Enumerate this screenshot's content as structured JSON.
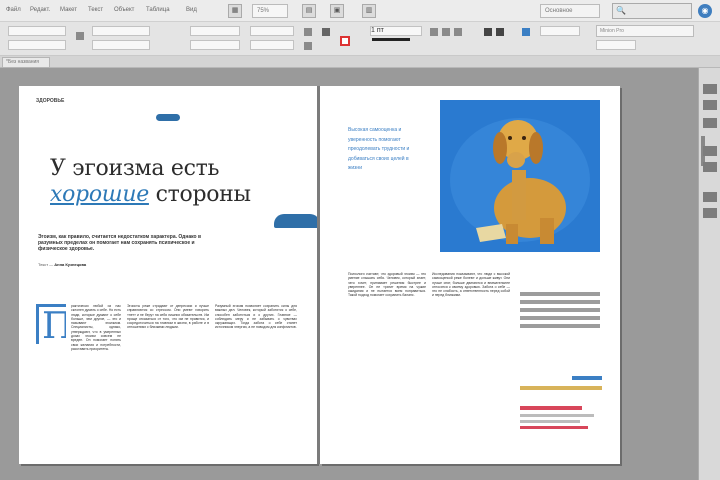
{
  "menubar": {
    "items": [
      "Файл",
      "Редакт.",
      "Макет",
      "Текст",
      "Объект",
      "Таблица",
      "Вид"
    ],
    "zoom": "75%",
    "workspace": "Основное",
    "search_placeholder": "🔍"
  },
  "controlbar": {
    "font_name": "Minion Pro",
    "stroke_weight": "1 пт"
  },
  "tab": {
    "label": "*Без названия"
  },
  "spread": {
    "left": {
      "runner": "ЗДОРОВЬЕ",
      "headline_line1": "У эгоизма есть",
      "headline_word2": "хорошие",
      "headline_word3": " стороны",
      "lead": "Эгоизм, как правило, считается недостатком характера. Однако в разумных пределах он помогает нам сохранять психическое и физическое здоровье.",
      "byline_prefix": "Текст — ",
      "byline_name": "Анна Кузнецова",
      "dropcap": "П",
      "col1": "рактически любой из нас склонен думать о себе. Но есть люди, которые думают о себе больше, чем другие, — это и называют эгоизмом. Специалисты, однако, утверждают, что в умеренных дозах эгоизм совсем не вреден. Он помогает понять свои желания и потребности, расставить приоритеты.",
      "col2": "Эгоисты реже страдают от депрессии и лучше справляются со стрессом. Они умеют говорить «нет» и не берут на себя лишних обязательств. Им проще отказаться от того, что им не нравится, и сосредоточиться на главном в жизни, в работе и в отношениях с близкими людьми.",
      "col3": "Разумный эгоизм позволяет сохранить силы для важных дел. Человек, который заботится о себе, способен заботиться и о других. Главное — соблюдать меру и не забывать о чувствах окружающих. Тогда забота о себе станет источником энергии, а не поводом для конфликтов."
    },
    "right": {
      "pull_quote": "Высокая самооценка и уверенность помогают преодолевать трудности и добиваться своих целей в жизни",
      "col1": "Психологи считают, что здоровый эгоизм — это умение слышать себя. Человек, который знает, чего хочет, принимает решения быстрее и увереннее. Он не тратит время на чужие ожидания и не пытается всем понравиться. Такой подход помогает сохранить баланс.",
      "col2": "Исследования показывают, что люди с высокой самооценкой реже болеют и дольше живут. Они лучше спят, больше двигаются и внимательнее относятся к своему здоровью. Забота о себе — это не слабость, а ответственность перед собой и перед близкими."
    }
  },
  "colors": {
    "accent": "#2d79b7",
    "pasteboard": "#9a9a9a"
  },
  "icons": [
    "search-icon",
    "grid-icon",
    "view-icon",
    "fill-swatch-icon",
    "stroke-swatch-icon"
  ]
}
